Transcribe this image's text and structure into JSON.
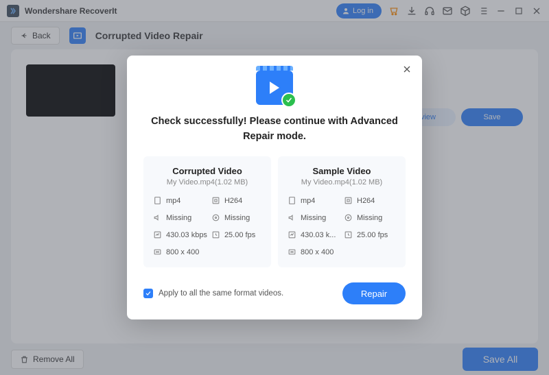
{
  "titlebar": {
    "app_name": "Wondershare RecoverIt",
    "login_label": "Log in"
  },
  "header": {
    "back_label": "Back",
    "mode_title": "Corrupted Video Repair"
  },
  "content": {
    "preview_label": "view",
    "save_label": "Save"
  },
  "footer": {
    "remove_all_label": "Remove All",
    "save_all_label": "Save All"
  },
  "modal": {
    "message": "Check successfully! Please continue with Advanced Repair mode.",
    "corrupted": {
      "title": "Corrupted Video",
      "subtitle": "My Video.mp4(1.02  MB)",
      "props": {
        "format": "mp4",
        "codec": "H264",
        "audio": "Missing",
        "audio2": "Missing",
        "bitrate": "430.03 kbps",
        "fps": "25.00 fps",
        "resolution": "800 x 400"
      }
    },
    "sample": {
      "title": "Sample Video",
      "subtitle": "My Video.mp4(1.02  MB)",
      "props": {
        "format": "mp4",
        "codec": "H264",
        "audio": "Missing",
        "audio2": "Missing",
        "bitrate": "430.03 k...",
        "fps": "25.00 fps",
        "resolution": "800 x 400"
      }
    },
    "apply_label": "Apply to all the same format videos.",
    "repair_label": "Repair"
  }
}
